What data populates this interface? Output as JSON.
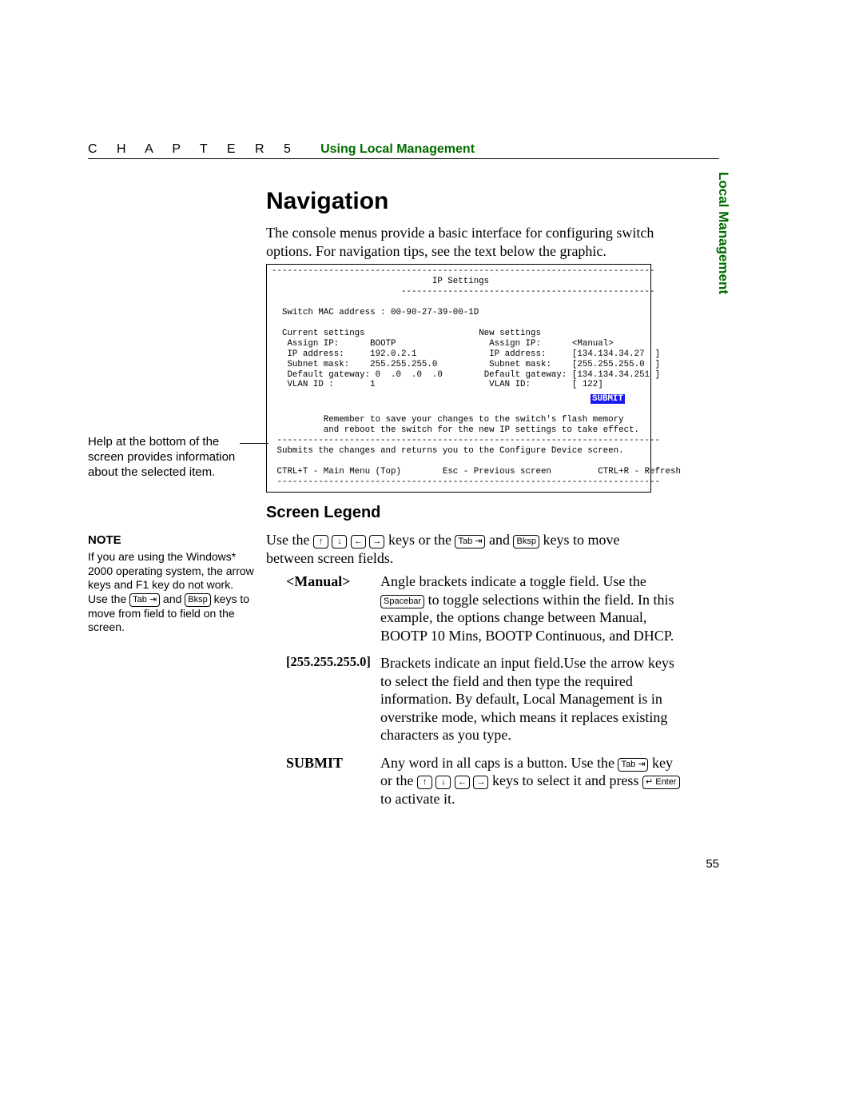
{
  "header": {
    "chapter": "C  H  A  P  T  E  R    5",
    "title": "Using Local Management"
  },
  "side_tab": "Local Management",
  "heading": "Navigation",
  "intro": "The console menus provide a basic interface for configuring switch options. For navigation tips, see the text below the graphic.",
  "console": {
    "hr": "--------------------------------------------------------------------------",
    "hr2": "-------------------------------------------------",
    "title": "IP Settings",
    "mac_label": "Switch MAC address :",
    "mac": "00-90-27-39-00-1D",
    "current_header": "Current settings",
    "new_header": "New settings",
    "rows": {
      "assign_ip_l": "Assign IP:",
      "assign_ip_cv": "BOOTP",
      "assign_ip_nv": "<Manual>",
      "ip_addr_l": "IP address:",
      "ip_addr_cv": "192.0.2.1",
      "ip_addr_nv": "[134.134.34.27  ]",
      "subnet_l": "Subnet mask:",
      "subnet_cv": "255.255.255.0",
      "subnet_nv": "[255.255.255.0  ]",
      "gateway_l": "Default gateway:",
      "gateway_cv": "0  .0  .0  .0",
      "gateway_nv": "[134.134.34.251 ]",
      "vlan_l": "VLAN ID :",
      "vlan_cv": "1",
      "vlan_l2": "VLAN ID:",
      "vlan_nv": "[ 122]"
    },
    "submit": "SUBMIT",
    "reminder1": "Remember to save your changes to the switch's flash memory",
    "reminder2": "and reboot the switch for the new IP settings to take effect.",
    "help": "Submits the changes and returns you to the Configure Device screen.",
    "footer_left": "CTRL+T - Main Menu (Top)",
    "footer_mid": "Esc - Previous screen",
    "footer_right": "CTRL+R - Refresh"
  },
  "margin_note": "Help at the bottom of the screen provides information about the selected item.",
  "legend": {
    "heading": "Screen Legend",
    "intro_prefix": "Use the ",
    "intro_mid1": " keys or the ",
    "intro_mid2": " and ",
    "intro_suffix": " keys to move between screen fields.",
    "items": [
      {
        "term": "<Manual>",
        "desc_a": "Angle brackets indicate a toggle field. Use the ",
        "desc_b": " to toggle selections within the field. In this example, the options change between Manual, BOOTP 10 Mins, BOOTP Continuous, and DHCP."
      },
      {
        "term": "[255.255.255.0]",
        "desc_a": "Brackets indicate an input field.Use the arrow keys to select the field and then type the required information. By default, Local Management is in overstrike mode, which means it replaces existing characters as you type."
      },
      {
        "term": "SUBMIT",
        "desc_a": "Any word in all caps is a button. Use the ",
        "desc_b": " key or the ",
        "desc_c": " keys to select it and press ",
        "desc_d": " to activate it."
      }
    ]
  },
  "note": {
    "heading": "NOTE",
    "body_a": "If you are using the Windows* 2000 operating system, the arrow keys and F1 key do not work. Use the ",
    "body_b": " and ",
    "body_c": " keys to move from field to field on the screen."
  },
  "keys": {
    "up": "↑",
    "down": "↓",
    "left": "←",
    "right": "→",
    "tab": "Tab ⇥",
    "bksp": "Bksp",
    "spacebar": "Spacebar",
    "enter": "↵ Enter"
  },
  "page_number": "55"
}
